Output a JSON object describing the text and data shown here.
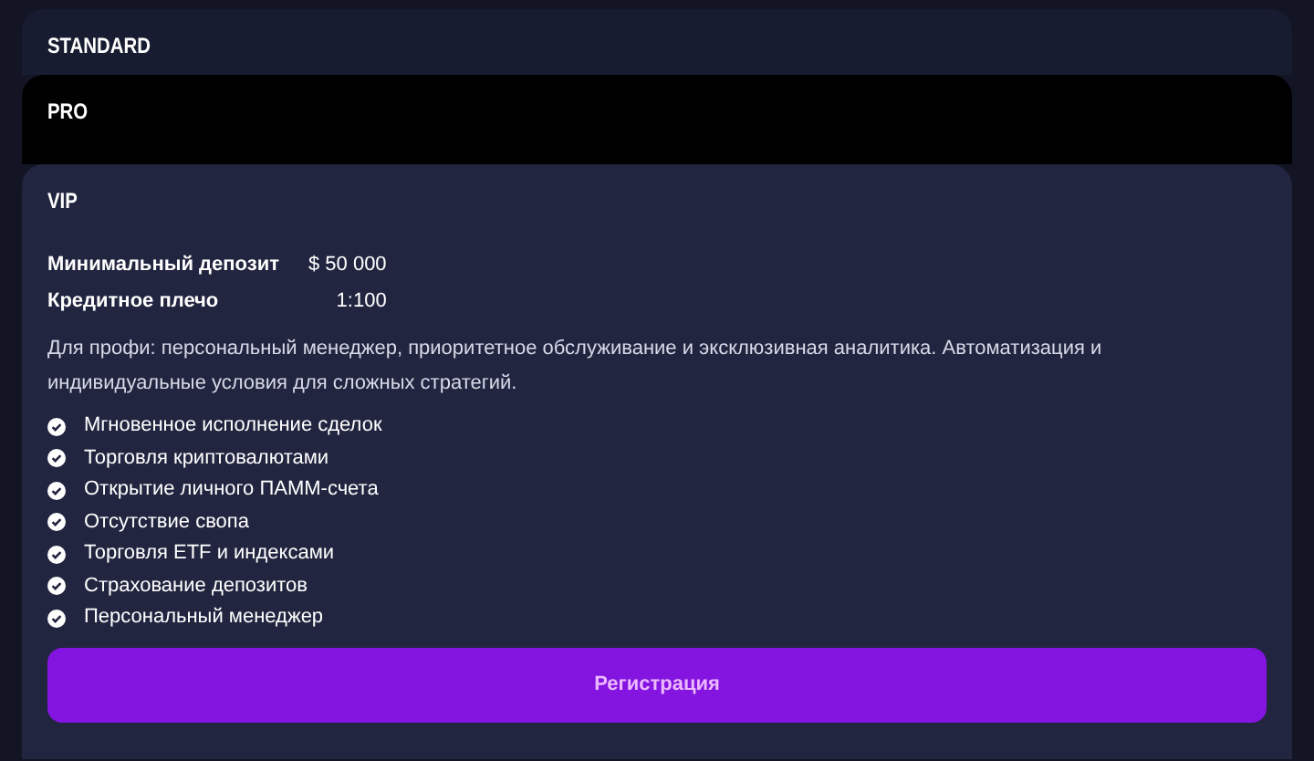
{
  "plans": [
    {
      "title": "STANDARD",
      "expanded": false,
      "hovered": false
    },
    {
      "title": "PRO",
      "expanded": false,
      "hovered": true
    },
    {
      "title": "VIP",
      "expanded": true,
      "hovered": false,
      "params": [
        {
          "label": "Минимальный депозит",
          "value": "$ 50 000"
        },
        {
          "label": "Кредитное плечо",
          "value": "1:100"
        }
      ],
      "description": "Для профи: персональный менеджер, приоритетное обслуживание и эксклюзивная аналитика. Автоматизация и индивидуальные условия для сложных стратегий.",
      "features": [
        "Мгновенное исполнение сделок",
        "Торговля криптовалютами",
        "Открытие личного ПАММ-счета",
        "Отсутствие свопа",
        "Торговля ETF и индексами",
        "Страхование депозитов",
        "Персональный менеджер"
      ],
      "button": "Регистрация"
    }
  ]
}
